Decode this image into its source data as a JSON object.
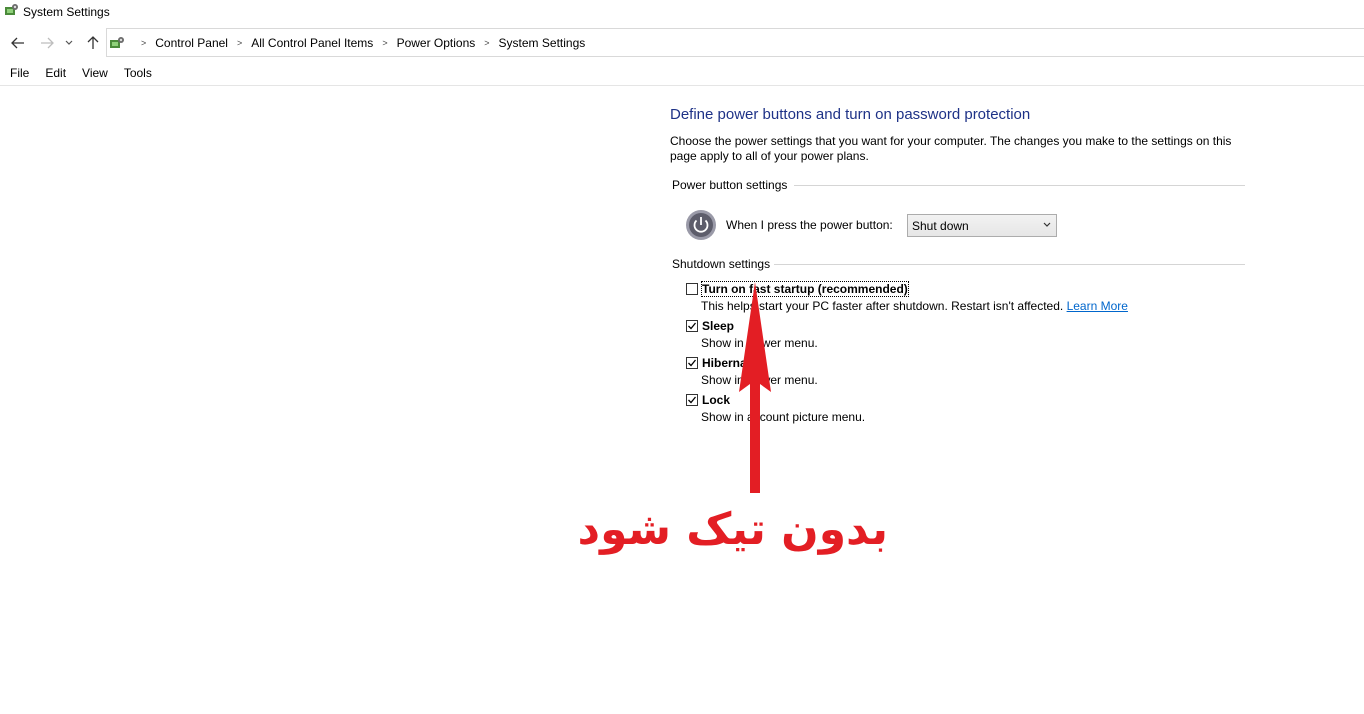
{
  "window": {
    "title": "System Settings"
  },
  "breadcrumb": [
    "Control Panel",
    "All Control Panel Items",
    "Power Options",
    "System Settings"
  ],
  "menu": [
    "File",
    "Edit",
    "View",
    "Tools"
  ],
  "page": {
    "title": "Define power buttons and turn on password protection",
    "description": "Choose the power settings that you want for your computer. The changes you make to the settings on this page apply to all of your power plans.",
    "power_group": "Power button settings",
    "power_label": "When I press the power button:",
    "power_select": "Shut down",
    "shutdown_group": "Shutdown settings",
    "options": [
      {
        "label": "Turn on fast startup (recommended)",
        "desc": "This helps start your PC faster after shutdown. Restart isn't affected.",
        "link": "Learn More",
        "checked": false
      },
      {
        "label": "Sleep",
        "desc": "Show in Power menu.",
        "checked": true
      },
      {
        "label": "Hibernate",
        "desc": "Show in Power menu.",
        "checked": true
      },
      {
        "label": "Lock",
        "desc": "Show in account picture menu.",
        "checked": true
      }
    ]
  },
  "annotation": {
    "text": "بدون تیک شود",
    "color": "#e31e24"
  },
  "colors": {
    "title": "#1e3287",
    "link": "#0066cc"
  }
}
